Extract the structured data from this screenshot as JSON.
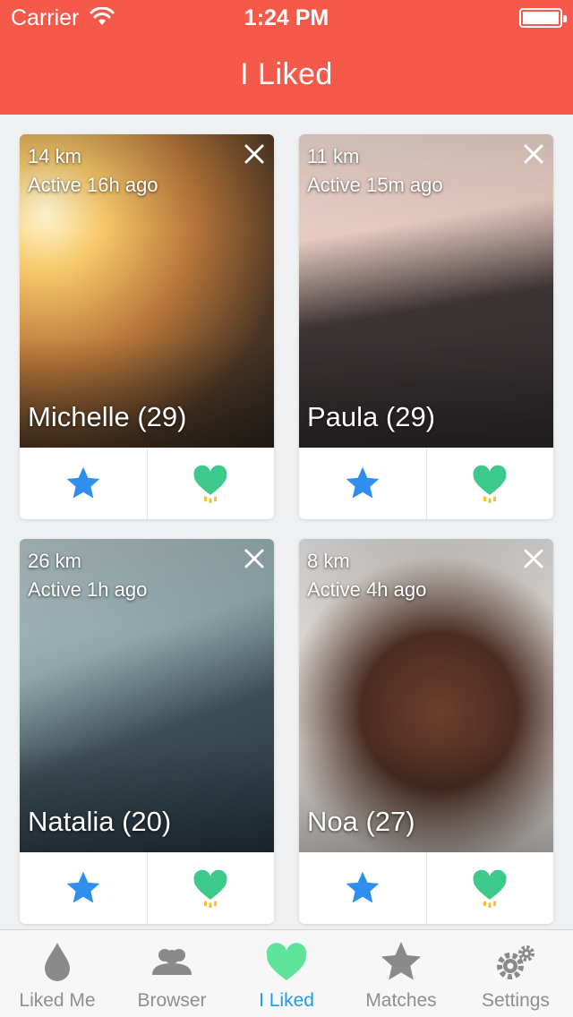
{
  "status": {
    "carrier": "Carrier",
    "time": "1:24 PM"
  },
  "header": {
    "title": "I Liked"
  },
  "colors": {
    "accent": "#f5594a",
    "star": "#2f8fef",
    "heart": "#3cc98a",
    "tab_active": "#1e9bf0"
  },
  "cards": [
    {
      "distance": "14 km",
      "active": "Active 16h ago",
      "name": "Michelle (29)"
    },
    {
      "distance": "11 km",
      "active": "Active 15m ago",
      "name": "Paula (29)"
    },
    {
      "distance": "26 km",
      "active": "Active 1h ago",
      "name": "Natalia (20)"
    },
    {
      "distance": "8 km",
      "active": "Active 4h ago",
      "name": "Noa (27)"
    }
  ],
  "tabs": [
    {
      "label": "Liked Me",
      "icon": "drop-icon"
    },
    {
      "label": "Browser",
      "icon": "people-icon"
    },
    {
      "label": "I Liked",
      "icon": "heart-icon",
      "active": true
    },
    {
      "label": "Matches",
      "icon": "star-icon"
    },
    {
      "label": "Settings",
      "icon": "gears-icon"
    }
  ]
}
